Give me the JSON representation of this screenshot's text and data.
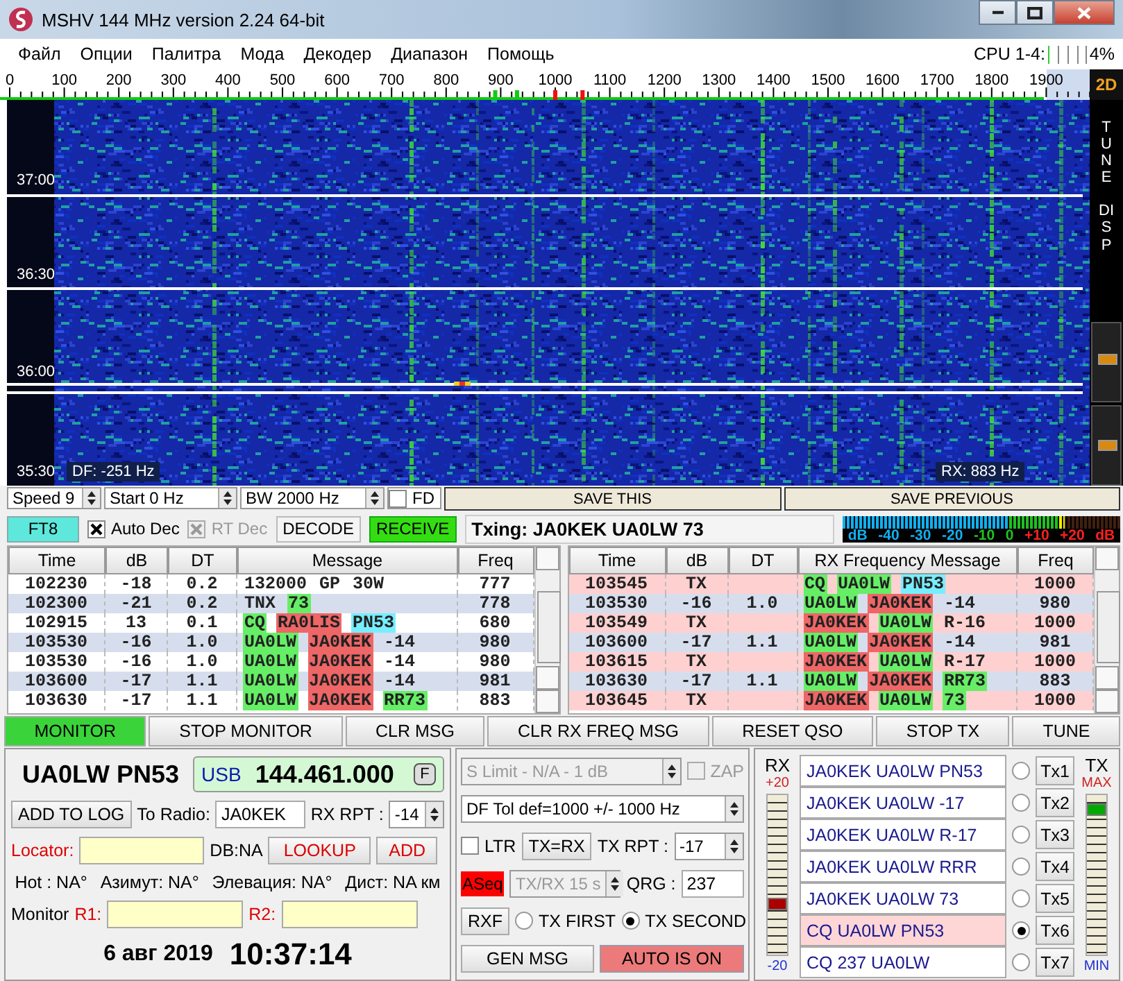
{
  "window": {
    "title": "MSHV 144 MHz version 2.24 64-bit"
  },
  "menu": [
    "Файл",
    "Опции",
    "Палитра",
    "Мода",
    "Декодер",
    "Диапазон",
    "Помощь"
  ],
  "cpu": {
    "label": "CPU 1-4:",
    "level": 0.04,
    "reading": "4%"
  },
  "scale": {
    "labels": [
      "0",
      "100",
      "200",
      "300",
      "400",
      "500",
      "600",
      "700",
      "800",
      "900",
      "1000",
      "1100",
      "1200",
      "1300",
      "1400",
      "1500",
      "1600",
      "1700",
      "1800",
      "1900"
    ],
    "view_button": "2D"
  },
  "waterfall": {
    "time_labels": [
      "37:00",
      "36:30",
      "36:00",
      "35:30"
    ],
    "df": "DF: -251 Hz",
    "rx": "RX: 883 Hz",
    "side_labels": [
      "TUNE",
      "DISP"
    ],
    "sliders": [
      {
        "level": 0.55
      },
      {
        "level": 0.5
      }
    ]
  },
  "controls": {
    "speed": "Speed 9",
    "start": "Start 0 Hz",
    "bw": "BW 2000 Hz",
    "fd": {
      "label": "FD",
      "checked": false
    },
    "save_this": "SAVE THIS",
    "save_previous": "SAVE PREVIOUS"
  },
  "decoder": {
    "mode": "FT8",
    "auto_dec": {
      "label": "Auto Dec",
      "checked": true,
      "disabled": false
    },
    "rt_dec": {
      "label": "RT Dec",
      "checked": true,
      "disabled": true
    },
    "decode": "DECODE",
    "receive": {
      "label": "RECEIVE",
      "on": true
    },
    "txing": "Txing: JA0KEK UA0LW 73",
    "meter_labels": [
      {
        "text": "dB",
        "kind": "low"
      },
      {
        "text": "-40",
        "kind": "low"
      },
      {
        "text": "-30",
        "kind": "low"
      },
      {
        "text": "-20",
        "kind": "low"
      },
      {
        "text": "-10",
        "kind": "normal"
      },
      {
        "text": "0",
        "kind": "normal"
      },
      {
        "text": "+10",
        "kind": "over"
      },
      {
        "text": "+20",
        "kind": "over"
      },
      {
        "text": "dB",
        "kind": "over"
      }
    ]
  },
  "tables": [
    {
      "columns": [
        "Time",
        "dB",
        "DT",
        "Message",
        "Freq"
      ],
      "rows": [
        {
          "kind": "rx",
          "time": "102230",
          "db": "-18",
          "dt": "0.2",
          "message": [
            {
              "text": "132000"
            },
            {
              "text": "GP"
            },
            {
              "text": "30W"
            }
          ],
          "freq": "777"
        },
        {
          "kind": "rx",
          "time": "102300",
          "db": "-21",
          "dt": "0.2",
          "message": [
            {
              "text": "TNX"
            },
            {
              "text": "73",
              "color": "#66ee66"
            }
          ],
          "freq": "778"
        },
        {
          "kind": "rx",
          "time": "102915",
          "db": "13",
          "dt": "0.1",
          "message": [
            {
              "text": "CQ",
              "color": "#66ee66"
            },
            {
              "text": "RA0LIS",
              "color": "#ee6666"
            },
            {
              "text": "PN53",
              "color": "#77eeff"
            }
          ],
          "freq": "680"
        },
        {
          "kind": "rx",
          "time": "103530",
          "db": "-16",
          "dt": "1.0",
          "message": [
            {
              "text": "UA0LW",
              "color": "#66ee66"
            },
            {
              "text": "JA0KEK",
              "color": "#ee6666"
            },
            {
              "text": "-14"
            }
          ],
          "freq": "980"
        },
        {
          "kind": "rx",
          "time": "103530",
          "db": "-16",
          "dt": "1.0",
          "message": [
            {
              "text": "UA0LW",
              "color": "#66ee66"
            },
            {
              "text": "JA0KEK",
              "color": "#ee6666"
            },
            {
              "text": "-14"
            }
          ],
          "freq": "980"
        },
        {
          "kind": "rx",
          "time": "103600",
          "db": "-17",
          "dt": "1.1",
          "message": [
            {
              "text": "UA0LW",
              "color": "#66ee66"
            },
            {
              "text": "JA0KEK",
              "color": "#ee6666"
            },
            {
              "text": "-14"
            }
          ],
          "freq": "981"
        },
        {
          "kind": "rx",
          "time": "103630",
          "db": "-17",
          "dt": "1.1",
          "message": [
            {
              "text": "UA0LW",
              "color": "#66ee66"
            },
            {
              "text": "JA0KEK",
              "color": "#ee6666"
            },
            {
              "text": "RR73",
              "color": "#66ee66"
            }
          ],
          "freq": "883"
        }
      ]
    },
    {
      "columns": [
        "Time",
        "dB",
        "DT",
        "RX Frequency Message",
        "Freq"
      ],
      "rows": [
        {
          "kind": "tx",
          "time": "103545",
          "db": "TX",
          "message": [
            {
              "text": "CQ",
              "color": "#66ee66"
            },
            {
              "text": "UA0LW",
              "color": "#66ee66"
            },
            {
              "text": "PN53",
              "color": "#77eeff"
            }
          ],
          "freq": "1000"
        },
        {
          "kind": "rx",
          "time": "103530",
          "db": "-16",
          "dt": "1.0",
          "message": [
            {
              "text": "UA0LW",
              "color": "#66ee66"
            },
            {
              "text": "JA0KEK",
              "color": "#ee6666"
            },
            {
              "text": "-14"
            }
          ],
          "freq": "980"
        },
        {
          "kind": "tx",
          "time": "103549",
          "db": "TX",
          "message": [
            {
              "text": "JA0KEK",
              "color": "#ee6666"
            },
            {
              "text": "UA0LW",
              "color": "#66ee66"
            },
            {
              "text": "R-16"
            }
          ],
          "freq": "1000"
        },
        {
          "kind": "rx",
          "time": "103600",
          "db": "-17",
          "dt": "1.1",
          "message": [
            {
              "text": "UA0LW",
              "color": "#66ee66"
            },
            {
              "text": "JA0KEK",
              "color": "#ee6666"
            },
            {
              "text": "-14"
            }
          ],
          "freq": "981"
        },
        {
          "kind": "tx",
          "time": "103615",
          "db": "TX",
          "message": [
            {
              "text": "JA0KEK",
              "color": "#ee6666"
            },
            {
              "text": "UA0LW",
              "color": "#66ee66"
            },
            {
              "text": "R-17"
            }
          ],
          "freq": "1000"
        },
        {
          "kind": "rx",
          "time": "103630",
          "db": "-17",
          "dt": "1.1",
          "message": [
            {
              "text": "UA0LW",
              "color": "#66ee66"
            },
            {
              "text": "JA0KEK",
              "color": "#ee6666"
            },
            {
              "text": "RR73",
              "color": "#66ee66"
            }
          ],
          "freq": "883"
        },
        {
          "kind": "tx",
          "time": "103645",
          "db": "TX",
          "message": [
            {
              "text": "JA0KEK",
              "color": "#ee6666"
            },
            {
              "text": "UA0LW",
              "color": "#66ee66"
            },
            {
              "text": "73",
              "color": "#66ee66"
            }
          ],
          "freq": "1000"
        }
      ]
    }
  ],
  "buttons": [
    {
      "label": "MONITOR",
      "on": true
    },
    {
      "label": "STOP MONITOR",
      "on": false
    },
    {
      "label": "CLR MSG",
      "on": false
    },
    {
      "label": "CLR RX FREQ MSG",
      "on": false
    },
    {
      "label": "RESET QSO",
      "on": false
    },
    {
      "label": "STOP TX",
      "on": false
    },
    {
      "label": "TUNE",
      "on": false
    }
  ],
  "station": {
    "call": "UA0LW PN53",
    "mode": "USB",
    "frequency": "144.461.000",
    "f_button": "F",
    "add_to_log": "ADD TO LOG",
    "to_radio_label": "To Radio:",
    "to_radio": "JA0KEK",
    "rx_rpt_label": "RX RPT :",
    "rx_rpt": "-14",
    "locator_label": "Locator:",
    "db": "DB:NA",
    "lookup": "LOOKUP",
    "add": "ADD",
    "info": [
      "Hot : NA°",
      "Азимут: NA°",
      "Элевация: NA°",
      "Дист: NA км"
    ],
    "monitor_label": "Monitor",
    "r1": "R1:",
    "r2": "R2:",
    "date": "6 авг 2019",
    "time": "10:37:14"
  },
  "sequence": {
    "s_limit": {
      "value": "S Limit - N/A - 1  dB",
      "disabled": true
    },
    "zap": {
      "label": "ZAP",
      "checked": false,
      "disabled": true
    },
    "df_tol": "DF Tol def=1000 +/-  1000  Hz",
    "ltr": {
      "label": "LTR",
      "checked": false
    },
    "tx_eq_rx": "TX=RX",
    "tx_rpt_label": "TX RPT :",
    "tx_rpt": "-17",
    "aseq": {
      "label": "ASeq",
      "on": true
    },
    "txrx": {
      "value": "TX/RX 15  s",
      "disabled": true
    },
    "qrg_label": "QRG :",
    "qrg": "237",
    "rxf": "RXF",
    "tx_order": [
      {
        "label": "TX FIRST",
        "selected": false
      },
      {
        "label": "TX SECOND",
        "selected": true
      }
    ],
    "gen_msg": "GEN MSG",
    "auto": {
      "label": "AUTO IS ON",
      "on": true
    }
  },
  "rx_gain": {
    "label": "RX",
    "max": "+20",
    "min": "-20",
    "level": 0.3
  },
  "tx_gain": {
    "label": "TX",
    "max": "MAX",
    "min": "MIN",
    "level": 0.95
  },
  "tx_messages": [
    {
      "text": "JA0KEK UA0LW PN53",
      "button": "Tx1",
      "selected": false
    },
    {
      "text": "JA0KEK UA0LW -17",
      "button": "Tx2",
      "selected": false
    },
    {
      "text": "JA0KEK UA0LW R-17",
      "button": "Tx3",
      "selected": false
    },
    {
      "text": "JA0KEK UA0LW RRR",
      "button": "Tx4",
      "selected": false
    },
    {
      "text": "JA0KEK UA0LW 73",
      "button": "Tx5",
      "selected": false
    },
    {
      "text": "CQ UA0LW PN53",
      "button": "Tx6",
      "selected": true
    },
    {
      "text": "CQ 237 UA0LW",
      "button": "Tx7",
      "selected": false
    }
  ]
}
